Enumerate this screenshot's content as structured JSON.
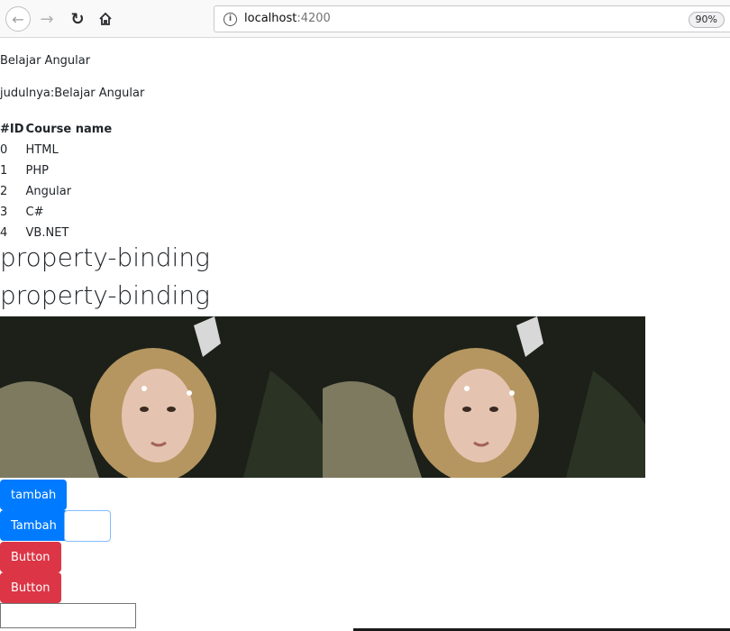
{
  "browser": {
    "url_host": "localhost",
    "url_port": ":4200",
    "zoom": "90%"
  },
  "page": {
    "title_text": "Belajar Angular",
    "subtitle_text": "judulnya:Belajar Angular",
    "table": {
      "headers": [
        "#ID",
        "Course name"
      ],
      "rows": [
        {
          "id": "0",
          "name": "HTML"
        },
        {
          "id": "1",
          "name": "PHP"
        },
        {
          "id": "2",
          "name": "Angular"
        },
        {
          "id": "3",
          "name": "C#"
        },
        {
          "id": "4",
          "name": "VB.NET"
        }
      ]
    },
    "heading1": "property-binding",
    "heading2": "property-binding",
    "buttons": {
      "tambah_small": "tambah",
      "tambah_cap": "Tambah",
      "button1": "Button",
      "button2": "Button"
    }
  },
  "colors": {
    "primary": "#007bff",
    "danger": "#dc3545"
  }
}
